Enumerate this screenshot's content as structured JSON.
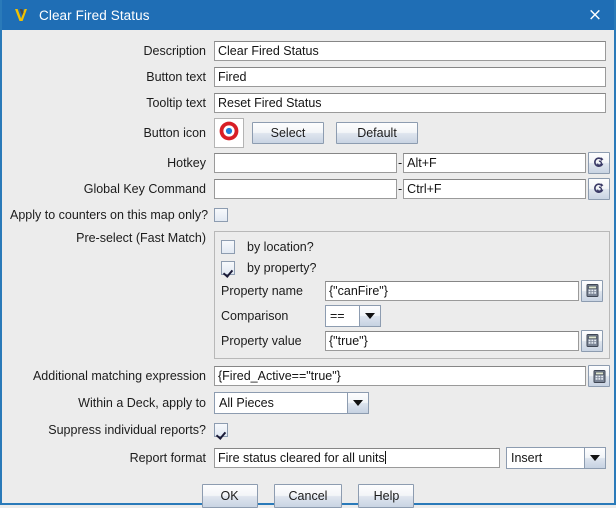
{
  "window": {
    "title": "Clear Fired Status",
    "logo_icon": "vassal-logo-icon",
    "close_icon": "×",
    "titlebar_color": "#1f6eb5",
    "border_color": "#2a7ab9",
    "background_color": "#ececec"
  },
  "fields": {
    "description": {
      "label": "Description",
      "value": "Clear Fired Status"
    },
    "button_text": {
      "label": "Button text",
      "value": "Fired"
    },
    "tooltip_text": {
      "label": "Tooltip text",
      "value": "Reset Fired Status"
    },
    "button_icon": {
      "label": "Button icon",
      "icon_name": "bullseye-target-icon",
      "icon_colors": {
        "ring": "#d81f26",
        "center": "#1f7fd8"
      },
      "select_label": "Select",
      "default_label": "Default"
    },
    "hotkey": {
      "label": "Hotkey",
      "name_value": "",
      "separator": "-",
      "key_value": "Alt+F",
      "picker_icon": "key-stroke-icon"
    },
    "global_key_command": {
      "label": "Global Key Command",
      "name_value": "",
      "separator": "-",
      "key_value": "Ctrl+F",
      "picker_icon": "key-stroke-icon"
    },
    "map_only": {
      "label": "Apply to counters on this map only?",
      "checked": false
    },
    "fast_match": {
      "label": "Pre-select (Fast Match)",
      "by_location": {
        "label": "by location?",
        "checked": false
      },
      "by_property": {
        "label": "by property?",
        "checked": true
      },
      "property_name": {
        "label": "Property name",
        "value": "{\"canFire\"}",
        "calc_icon": "calculator-icon"
      },
      "comparison": {
        "label": "Comparison",
        "value": "==",
        "arrow_icon": "chevron-down-icon"
      },
      "property_value": {
        "label": "Property value",
        "value": "{\"true\"}",
        "calc_icon": "calculator-icon"
      }
    },
    "additional_expression": {
      "label": "Additional matching expression",
      "value": "{Fired_Active==\"true\"}",
      "calc_icon": "calculator-icon"
    },
    "deck_apply": {
      "label": "Within a Deck, apply to",
      "value": "All Pieces",
      "arrow_icon": "chevron-down-icon"
    },
    "suppress_reports": {
      "label": "Suppress individual reports?",
      "checked": true
    },
    "report_format": {
      "label": "Report format",
      "value": "Fire status cleared for all units",
      "insert_value": "Insert",
      "arrow_icon": "chevron-down-icon"
    }
  },
  "buttons": {
    "ok": "OK",
    "cancel": "Cancel",
    "help": "Help"
  }
}
